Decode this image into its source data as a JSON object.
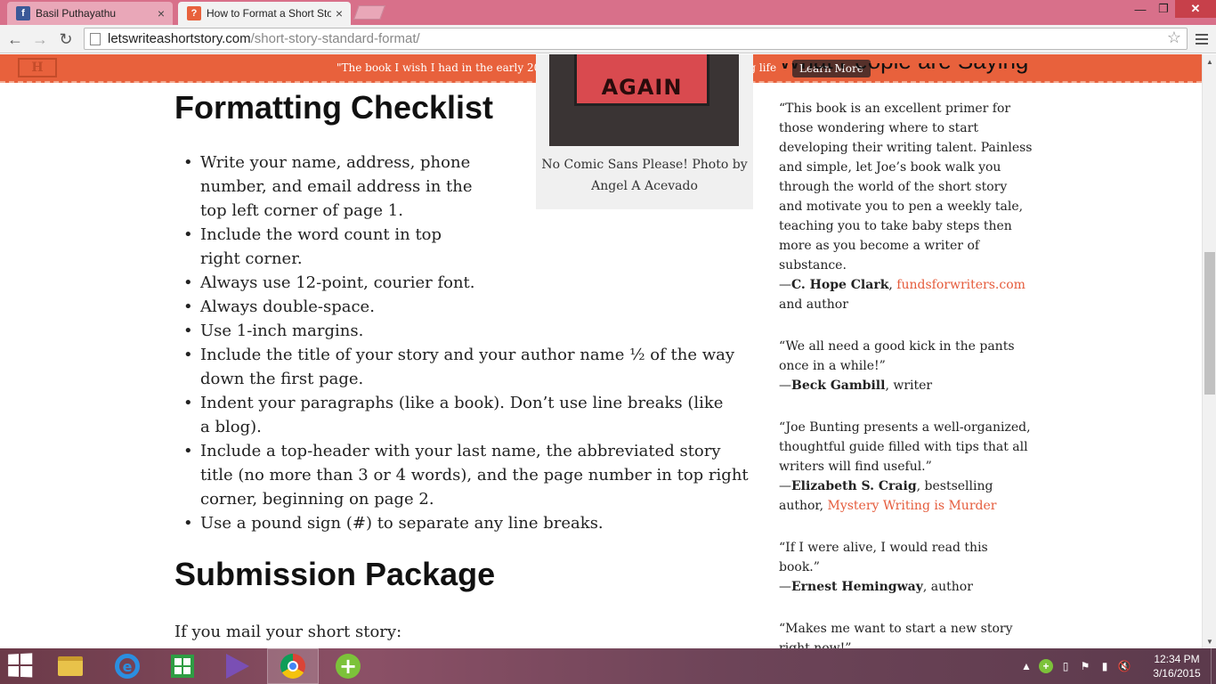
{
  "browser": {
    "tabs": [
      {
        "title": "Basil Puthayathu",
        "favicon": "facebook-icon",
        "favicon_color": "#3b5998"
      },
      {
        "title": "How to Format a Short Sto",
        "favicon": "site-icon",
        "favicon_color": "#e8613c"
      }
    ],
    "url_domain": "letswriteashortstory.com",
    "url_path": "/short-story-standard-format/"
  },
  "promo": {
    "text": "\"The book I wish I had in the early 2000's when I first committed to a writing life",
    "button": "Learn More",
    "color": "#e8613c"
  },
  "article": {
    "heading_partial": "",
    "heading": "Formatting Checklist",
    "checklist": [
      "Write your name, address, phone number, and email address in the top left corner of page 1.",
      "Include the word count in top right corner.",
      "Always use 12-point, courier font.",
      "Always double-space.",
      "Use 1-inch margins.",
      "Include the title of your story and your author name ½ of the way down the first page.",
      "Indent your paragraphs (like a book). Don’t use line breaks (like a blog).",
      "Include a top-header with your last name, the abbreviated story title (no more than 3 or 4 words), and the page number in top right corner, beginning on page 2.",
      "Use a pound sign (#) to separate any line breaks."
    ],
    "figure": {
      "sign_text": "AGAIN",
      "caption": "No Comic Sans Please! Photo by Angel A Acevado"
    },
    "submission_heading": "Submission Package",
    "mail_text": "If you mail your short story:"
  },
  "sidebar": {
    "heading": "What People are Saying",
    "testimonials": [
      {
        "quote": "“This book is an excellent primer for those wondering where to start developing their writing talent. Painless and simple, let Joe’s book walk you through the world of the short story and motivate you to pen a weekly tale, teaching you to take baby steps then more as you become a writer of substance.",
        "dash": "—",
        "name": "C. Hope Clark",
        "sep": ", ",
        "link": "fundsforwriters.com",
        "rest": " and author"
      },
      {
        "quote": "“We all need a good kick in the pants once in a while!”",
        "dash": "—",
        "name": "Beck Gambill",
        "sep": ", writer",
        "link": "",
        "rest": ""
      },
      {
        "quote": "“Joe Bunting presents a well-organized, thoughtful guide filled with tips that all writers will find useful.”",
        "dash": "—",
        "name": "Elizabeth S. Craig",
        "sep": ", bestselling author, ",
        "link": "Mystery Writing is Murder",
        "rest": ""
      },
      {
        "quote": "“If I were alive, I would read this book.”",
        "dash": "—",
        "name": "Ernest Hemingway",
        "sep": ", author",
        "link": "",
        "rest": ""
      },
      {
        "quote": "“Makes me want to start a new story right now!”",
        "dash": "",
        "name": "",
        "sep": "",
        "link": "",
        "rest": ""
      }
    ],
    "link_color": "#e55b3b"
  },
  "taskbar": {
    "apps": [
      "file-explorer-icon",
      "internet-explorer-icon",
      "store-icon",
      "visual-studio-icon",
      "chrome-icon",
      "add-app-icon"
    ],
    "time": "12:34 PM",
    "date": "3/16/2015"
  }
}
